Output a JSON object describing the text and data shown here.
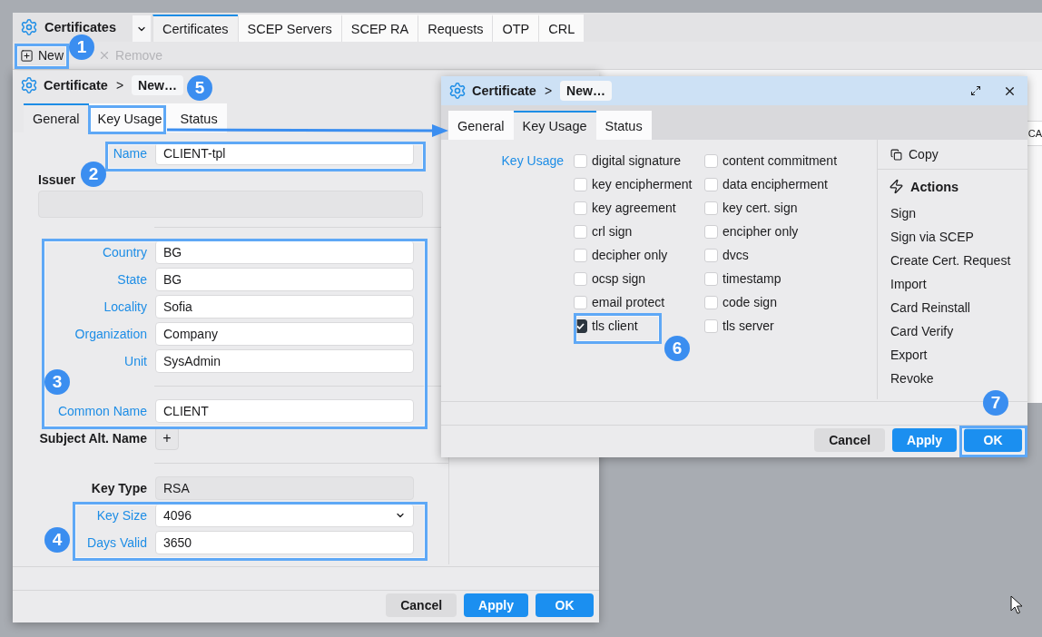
{
  "app": {
    "title": "Certificates",
    "tabs": [
      {
        "label": "Certificates",
        "selected": true
      },
      {
        "label": "SCEP Servers",
        "selected": false
      },
      {
        "label": "SCEP RA",
        "selected": false
      },
      {
        "label": "Requests",
        "selected": false
      },
      {
        "label": "OTP",
        "selected": false
      },
      {
        "label": "CRL",
        "selected": false
      }
    ],
    "toolbar": [
      {
        "kind": "new",
        "label": "New",
        "disabled": false
      },
      {
        "kind": "remove",
        "label": "Remove",
        "disabled": true
      }
    ],
    "table": {
      "columns": [
        "CA"
      ]
    }
  },
  "left_dialog": {
    "title": "Certificate",
    "separator": ">",
    "breadcrumb": "New…",
    "tabs": [
      {
        "label": "General",
        "selected": true
      },
      {
        "label": "Key Usage",
        "selected": false
      },
      {
        "label": "Status",
        "selected": false
      }
    ],
    "sections": [
      [
        {
          "kind": "text",
          "label": "Name",
          "value": "CLIENT-tpl",
          "emphasized": true
        },
        {
          "kind": "block",
          "label": "Issuer",
          "emphasized": false
        }
      ],
      [
        {
          "kind": "text",
          "label": "Country",
          "value": "BG",
          "emphasized": true
        },
        {
          "kind": "text",
          "label": "State",
          "value": "BG",
          "emphasized": true
        },
        {
          "kind": "text",
          "label": "Locality",
          "value": "Sofia",
          "emphasized": true
        },
        {
          "kind": "text",
          "label": "Organization",
          "value": "Company",
          "emphasized": true
        },
        {
          "kind": "text",
          "label": "Unit",
          "value": "SysAdmin",
          "emphasized": true
        }
      ],
      [
        {
          "kind": "text",
          "label": "Common Name",
          "value": "CLIENT",
          "emphasized": true
        },
        {
          "kind": "add",
          "label": "Subject Alt. Name",
          "button": "+",
          "emphasized": false
        }
      ],
      [
        {
          "kind": "readonly",
          "label": "Key Type",
          "value": "RSA",
          "emphasized": false
        },
        {
          "kind": "select",
          "label": "Key Size",
          "value": "4096",
          "emphasized": true
        },
        {
          "kind": "text",
          "label": "Days Valid",
          "value": "3650",
          "emphasized": true
        }
      ]
    ],
    "buttons": [
      {
        "kind": "secondary",
        "label": "Cancel"
      },
      {
        "kind": "primary",
        "label": "Apply"
      },
      {
        "kind": "primary",
        "label": "OK"
      }
    ]
  },
  "right_dialog": {
    "title": "Certificate",
    "separator": ">",
    "breadcrumb": "New…",
    "tabs": [
      {
        "label": "General",
        "selected": false
      },
      {
        "label": "Key Usage",
        "selected": true
      },
      {
        "label": "Status",
        "selected": false
      }
    ],
    "key_usage": {
      "label": "Key Usage",
      "options": [
        {
          "label": "digital signature",
          "checked": false
        },
        {
          "label": "content commitment",
          "checked": false
        },
        {
          "label": "key encipherment",
          "checked": false
        },
        {
          "label": "data encipherment",
          "checked": false
        },
        {
          "label": "key agreement",
          "checked": false
        },
        {
          "label": "key cert. sign",
          "checked": false
        },
        {
          "label": "crl sign",
          "checked": false
        },
        {
          "label": "encipher only",
          "checked": false
        },
        {
          "label": "decipher only",
          "checked": false
        },
        {
          "label": "dvcs",
          "checked": false
        },
        {
          "label": "ocsp sign",
          "checked": false
        },
        {
          "label": "timestamp",
          "checked": false
        },
        {
          "label": "email protect",
          "checked": false
        },
        {
          "label": "code sign",
          "checked": false
        },
        {
          "label": "tls client",
          "checked": true
        },
        {
          "label": "tls server",
          "checked": false
        }
      ]
    },
    "side_panel": {
      "copy": "Copy",
      "actions_title": "Actions",
      "actions": [
        "Sign",
        "Sign via SCEP",
        "Create Cert. Request",
        "Import",
        "Card Reinstall",
        "Card Verify",
        "Export",
        "Revoke"
      ]
    },
    "buttons": [
      {
        "kind": "secondary",
        "label": "Cancel"
      },
      {
        "kind": "primary",
        "label": "Apply"
      },
      {
        "kind": "primary",
        "label": "OK"
      }
    ]
  },
  "annotations": [
    "1",
    "2",
    "3",
    "4",
    "5",
    "6",
    "7"
  ]
}
